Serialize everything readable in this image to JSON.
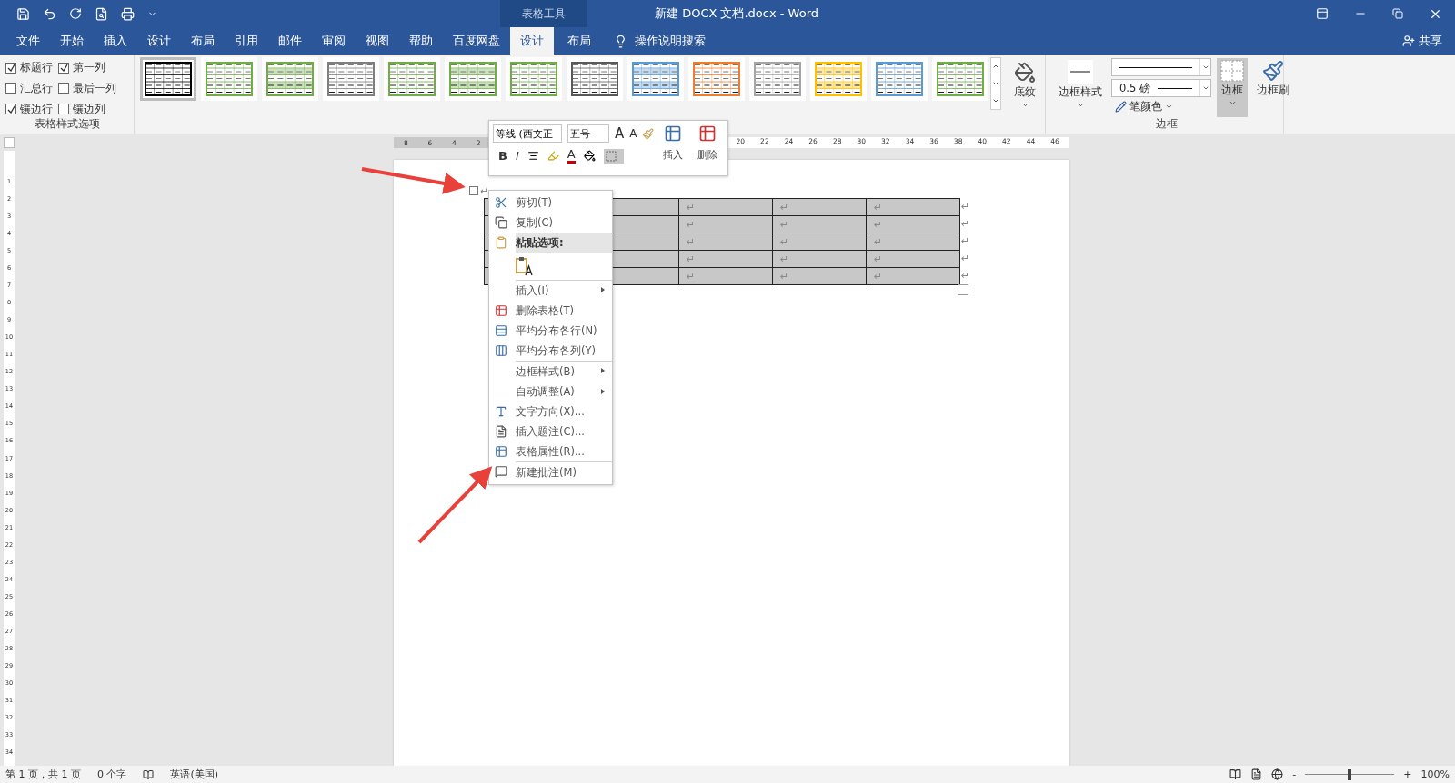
{
  "title_bar": {
    "context_group": "表格工具",
    "title": "新建 DOCX 文档.docx  -  Word"
  },
  "tabs": [
    {
      "label": "文件",
      "selected": false
    },
    {
      "label": "开始",
      "selected": false
    },
    {
      "label": "插入",
      "selected": false
    },
    {
      "label": "设计",
      "selected": false
    },
    {
      "label": "布局",
      "selected": false
    },
    {
      "label": "引用",
      "selected": false
    },
    {
      "label": "邮件",
      "selected": false
    },
    {
      "label": "审阅",
      "selected": false
    },
    {
      "label": "视图",
      "selected": false
    },
    {
      "label": "帮助",
      "selected": false
    },
    {
      "label": "百度网盘",
      "selected": false
    },
    {
      "label": "设计",
      "selected": true
    },
    {
      "label": "布局",
      "selected": false
    }
  ],
  "tell_me": "操作说明搜索",
  "share": "共享",
  "ribbon": {
    "style_options": {
      "label": "表格样式选项",
      "checkboxes": [
        {
          "label": "标题行",
          "checked": true
        },
        {
          "label": "第一列",
          "checked": true
        },
        {
          "label": "汇总行",
          "checked": false
        },
        {
          "label": "最后一列",
          "checked": false
        },
        {
          "label": "镶边行",
          "checked": true
        },
        {
          "label": "镶边列",
          "checked": false
        }
      ]
    },
    "styles": [
      {
        "color": "#000000",
        "selected": true
      },
      {
        "color": "#70ad47",
        "selected": false
      },
      {
        "color": "#70ad47",
        "selected": false
      },
      {
        "color": "#7f7f7f",
        "selected": false
      },
      {
        "color": "#70ad47",
        "selected": false
      },
      {
        "color": "#70ad47",
        "selected": false
      },
      {
        "color": "#70ad47",
        "selected": false
      },
      {
        "color": "#595959",
        "selected": false
      },
      {
        "color": "#5b9bd5",
        "selected": false
      },
      {
        "color": "#ed7d31",
        "selected": false
      },
      {
        "color": "#a5a5a5",
        "selected": false
      },
      {
        "color": "#ffc000",
        "selected": false
      },
      {
        "color": "#5b9bd5",
        "selected": false
      },
      {
        "color": "#70ad47",
        "selected": false
      }
    ],
    "shading": "底纹",
    "borders": {
      "label": "边框",
      "border_styles": "边框样式",
      "line_weight": "0.5 磅",
      "pen_color": "笔颜色",
      "borders_button": {
        "label": "边框",
        "selected": true
      },
      "border_painter": "边框刷"
    }
  },
  "ruler": {
    "left_labels": [
      "8",
      "6",
      "4",
      "2"
    ],
    "right_labels": [
      "20",
      "22",
      "24",
      "26",
      "28",
      "30",
      "32",
      "34",
      "36",
      "38",
      "40",
      "42",
      "44",
      "46"
    ]
  },
  "vertical_ruler": [
    "1",
    "2",
    "3",
    "4",
    "5",
    "6",
    "7",
    "8",
    "9",
    "10",
    "11",
    "12",
    "13",
    "14",
    "15",
    "16",
    "17",
    "18",
    "19",
    "20",
    "21",
    "22",
    "23",
    "24",
    "25",
    "26",
    "27",
    "28",
    "29",
    "30",
    "31",
    "32",
    "33",
    "34"
  ],
  "mini_toolbar": {
    "font": "等线 (西文正",
    "size": "五号",
    "grow": "A",
    "shrink": "A",
    "bold": "B",
    "italic": "I",
    "font_color": "A",
    "insert": "插入",
    "delete": "删除"
  },
  "anchor_mark": "↵",
  "table": {
    "rows": [
      {
        "cells": [
          "↵",
          "↵",
          "↵"
        ],
        "row_end": "↵"
      },
      {
        "cells": [
          "↵",
          "↵",
          "↵"
        ],
        "row_end": "↵"
      },
      {
        "cells": [
          "↵",
          "↵",
          "↵"
        ],
        "row_end": "↵"
      },
      {
        "cells": [
          "↵",
          "↵",
          "↵"
        ],
        "row_end": "↵"
      },
      {
        "cells": [
          "↵",
          "↵",
          "↵"
        ],
        "row_end": "↵"
      }
    ]
  },
  "context_menu": [
    {
      "kind": "command",
      "label": "剪切(T)",
      "has_submenu": false,
      "separator_before": false,
      "highlighted": false
    },
    {
      "kind": "command",
      "label": "复制(C)",
      "has_submenu": false,
      "separator_before": false,
      "highlighted": false
    },
    {
      "kind": "header",
      "label": "粘贴选项:",
      "has_submenu": false,
      "separator_before": false,
      "highlighted": true
    },
    {
      "kind": "paste",
      "has_submenu": false,
      "separator_before": false,
      "highlighted": false
    },
    {
      "kind": "command",
      "label": "插入(I)",
      "has_submenu": true,
      "separator_before": true,
      "highlighted": false
    },
    {
      "kind": "command",
      "label": "删除表格(T)",
      "has_submenu": false,
      "separator_before": false,
      "highlighted": false
    },
    {
      "kind": "command",
      "label": "平均分布各行(N)",
      "has_submenu": false,
      "separator_before": false,
      "highlighted": false
    },
    {
      "kind": "command",
      "label": "平均分布各列(Y)",
      "has_submenu": false,
      "separator_before": false,
      "highlighted": false
    },
    {
      "kind": "command",
      "label": "边框样式(B)",
      "has_submenu": true,
      "separator_before": true,
      "highlighted": false
    },
    {
      "kind": "command",
      "label": "自动调整(A)",
      "has_submenu": true,
      "separator_before": false,
      "highlighted": false
    },
    {
      "kind": "command",
      "label": "文字方向(X)...",
      "has_submenu": false,
      "separator_before": false,
      "highlighted": false
    },
    {
      "kind": "command",
      "label": "插入题注(C)...",
      "has_submenu": false,
      "separator_before": false,
      "highlighted": false
    },
    {
      "kind": "command",
      "label": "表格属性(R)...",
      "has_submenu": false,
      "separator_before": false,
      "highlighted": false
    },
    {
      "kind": "command",
      "label": "新建批注(M)",
      "has_submenu": false,
      "separator_before": true,
      "highlighted": false
    }
  ],
  "status_bar": {
    "page": "第 1 页，共 1 页",
    "words": "0 个字",
    "language": "英语(美国)",
    "zoom": {
      "minus": "-",
      "plus": "+",
      "level": 0.5,
      "percent": "100%"
    }
  }
}
